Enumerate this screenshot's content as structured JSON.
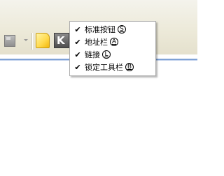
{
  "toolbar": {
    "buttons": [
      {
        "icon": "gray-app-icon"
      },
      {
        "icon": "dropdown-arrow-icon"
      },
      {
        "icon": "sticky-note-icon"
      },
      {
        "icon": "k-app-icon",
        "glyph": "K"
      }
    ]
  },
  "context_menu": {
    "items": [
      {
        "label": "标准按钮",
        "accel": "S",
        "checked": true,
        "check_glyph": "✔"
      },
      {
        "label": "地址栏",
        "accel": "A",
        "checked": true,
        "check_glyph": "✔"
      },
      {
        "label": "链接",
        "accel": "L",
        "checked": true,
        "check_glyph": "✔"
      },
      {
        "label": "锁定工具栏",
        "accel": "B",
        "checked": true,
        "check_glyph": "✔"
      }
    ]
  },
  "colors": {
    "toolbar_bg": "#ece9d8",
    "separator_blue": "#7fa2d6",
    "menu_border": "#acacac"
  }
}
